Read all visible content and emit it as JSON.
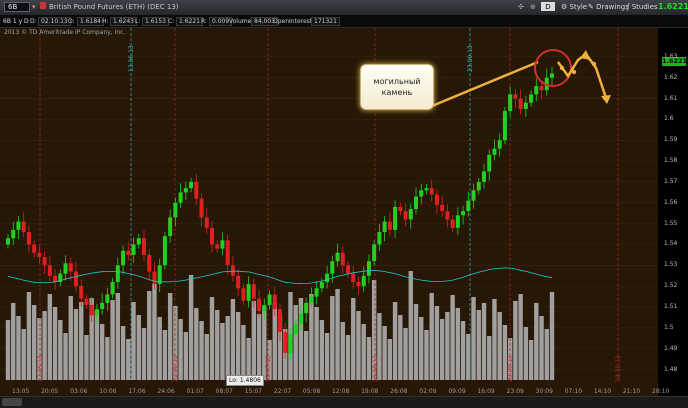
{
  "toolbar": {
    "symbol": "6B",
    "name": "British Pound Futures (ETH) (DEC 13)",
    "price": "1.6221",
    "buttons": [
      "Style",
      "Drawings",
      "Studies"
    ]
  },
  "infobar": {
    "period": "6B 1 y D",
    "fields": [
      {
        "label": "D:",
        "value": "02.10.13"
      },
      {
        "label": "O:",
        "value": "1.6184"
      },
      {
        "label": "H:",
        "value": "1.6243"
      },
      {
        "label": "L:",
        "value": "1.6153"
      },
      {
        "label": "C:",
        "value": "1.6221"
      },
      {
        "label": "R:",
        "value": "0.009"
      },
      {
        "label": "Volume",
        "value": "84,003"
      },
      {
        "label": "OpenInterest",
        "value": "171321"
      }
    ]
  },
  "copyright": "2013 © TD Ameritrade IP Company, Inc.",
  "callout": {
    "line1": "могильный",
    "line2": "камень"
  },
  "low_label": "Lo: 1.4806",
  "price_axis": [
    "1.63",
    "1.62",
    "1.61",
    "1.6",
    "1.59",
    "1.58",
    "1.57",
    "1.56",
    "1.55",
    "1.54",
    "1.53",
    "1.52",
    "1.51",
    "1.5",
    "1.49",
    "1.48"
  ],
  "time_axis": [
    "13:05",
    "20:05",
    "03:06",
    "10:06",
    "17:06",
    "24:06",
    "01:07",
    "08:07",
    "15:07",
    "22:07",
    "05:08",
    "12:08",
    "19:08",
    "26:08",
    "02:09",
    "09:09",
    "16:09",
    "23:09",
    "30:09",
    "07:10",
    "14:10",
    "21:10",
    "28:10"
  ],
  "red_markers": [
    "17.05.13",
    "21.06.13",
    "19.07.13",
    "16.08.13",
    "20.09.13",
    "18.10.13"
  ],
  "cyan_markers": [
    "13.06.13",
    "23.09.13"
  ],
  "colors": {
    "up": "#22d022",
    "down": "#e02020",
    "volume": "#b8b8b8",
    "oi": "#20c8c8",
    "arrow": "#f0b040",
    "circle": "#d03030"
  },
  "chart_data": {
    "type": "candlestick",
    "ylim": [
      1.475,
      1.64
    ],
    "closes": [
      1.543,
      1.547,
      1.551,
      1.546,
      1.54,
      1.536,
      1.534,
      1.53,
      1.525,
      1.522,
      1.526,
      1.531,
      1.527,
      1.52,
      1.514,
      1.511,
      1.506,
      1.509,
      1.512,
      1.516,
      1.522,
      1.53,
      1.537,
      1.535,
      1.54,
      1.543,
      1.535,
      1.527,
      1.521,
      1.53,
      1.544,
      1.553,
      1.56,
      1.565,
      1.567,
      1.57,
      1.562,
      1.553,
      1.548,
      1.54,
      1.538,
      1.542,
      1.53,
      1.525,
      1.519,
      1.513,
      1.521,
      1.514,
      1.508,
      1.511,
      1.516,
      1.509,
      1.498,
      1.488,
      1.497,
      1.502,
      1.507,
      1.512,
      1.515,
      1.519,
      1.522,
      1.526,
      1.532,
      1.536,
      1.53,
      1.526,
      1.522,
      1.52,
      1.525,
      1.532,
      1.54,
      1.546,
      1.551,
      1.547,
      1.558,
      1.556,
      1.552,
      1.557,
      1.563,
      1.566,
      1.567,
      1.564,
      1.559,
      1.556,
      1.552,
      1.548,
      1.554,
      1.556,
      1.561,
      1.566,
      1.57,
      1.575,
      1.583,
      1.586,
      1.59,
      1.604,
      1.612,
      1.61,
      1.605,
      1.608,
      1.612,
      1.616,
      1.614,
      1.62,
      1.622
    ]
  }
}
